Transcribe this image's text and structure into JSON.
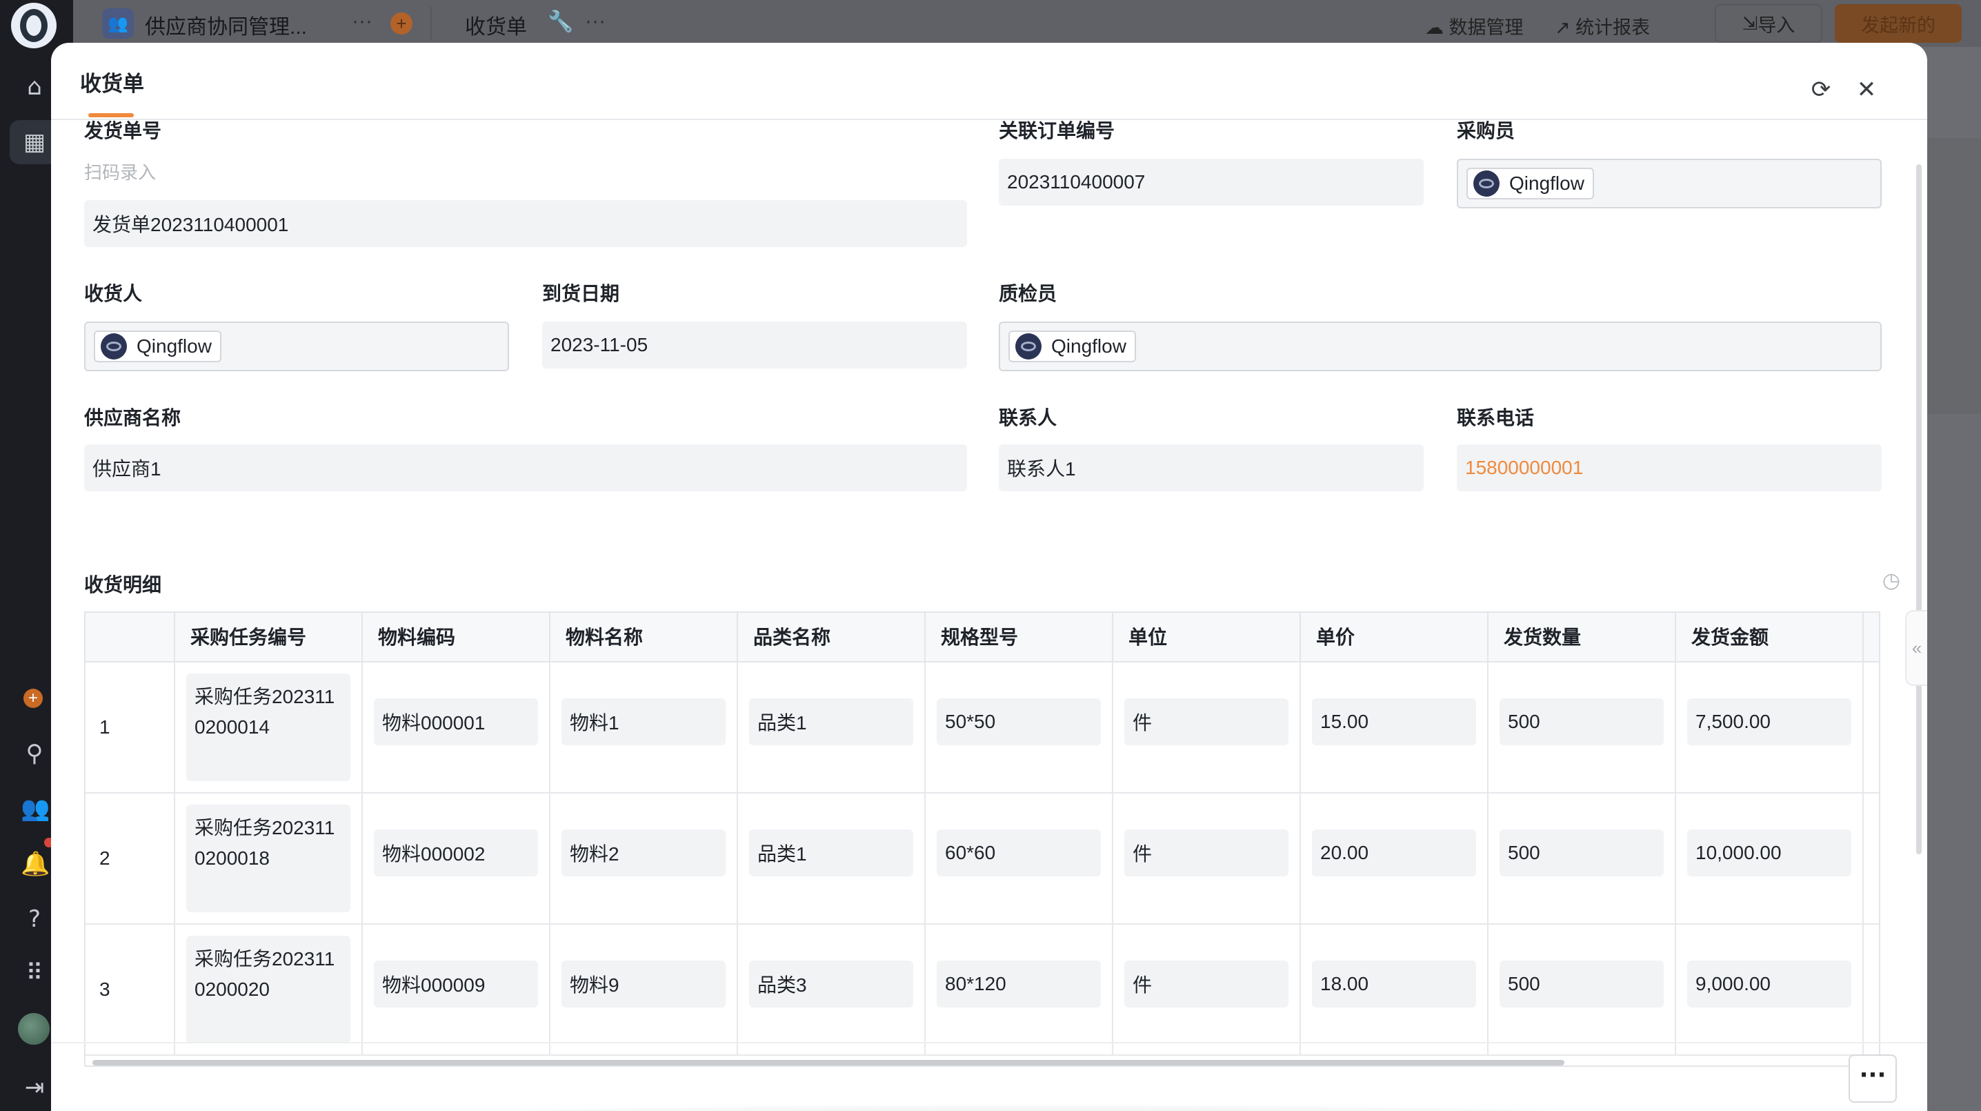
{
  "topbar": {
    "app_name": "供应商协同管理...",
    "more_dots": "···",
    "form_name": "收货单",
    "data_manage": "数据管理",
    "stats_report": "统计报表",
    "import": "导入",
    "new": "发起新的"
  },
  "modal": {
    "title": "收货单",
    "fields": {
      "shipment_no": {
        "label": "发货单号",
        "hint": "扫码录入",
        "value": "发货单2023110400001"
      },
      "order_no": {
        "label": "关联订单编号",
        "value": "2023110400007"
      },
      "purchaser": {
        "label": "采购员",
        "value": "Qingflow"
      },
      "receiver": {
        "label": "收货人",
        "value": "Qingflow"
      },
      "arrival_date": {
        "label": "到货日期",
        "value": "2023-11-05"
      },
      "inspector": {
        "label": "质检员",
        "value": "Qingflow"
      },
      "supplier": {
        "label": "供应商名称",
        "value": "供应商1"
      },
      "contact": {
        "label": "联系人",
        "value": "联系人1"
      },
      "phone": {
        "label": "联系电话",
        "value": "15800000001"
      }
    },
    "details": {
      "title": "收货明细",
      "columns": [
        "采购任务编号",
        "物料编码",
        "物料名称",
        "品类名称",
        "规格型号",
        "单位",
        "单价",
        "发货数量",
        "发货金额"
      ],
      "rows": [
        {
          "idx": "1",
          "task": "采购任务2023110200014",
          "code": "物料000001",
          "name": "物料1",
          "category": "品类1",
          "spec": "50*50",
          "unit": "件",
          "price": "15.00",
          "qty": "500",
          "amount": "7,500.00"
        },
        {
          "idx": "2",
          "task": "采购任务2023110200018",
          "code": "物料000002",
          "name": "物料2",
          "category": "品类1",
          "spec": "60*60",
          "unit": "件",
          "price": "20.00",
          "qty": "500",
          "amount": "10,000.00"
        },
        {
          "idx": "3",
          "task": "采购任务2023110200020",
          "code": "物料000009",
          "name": "物料9",
          "category": "品类3",
          "spec": "80*120",
          "unit": "件",
          "price": "18.00",
          "qty": "500",
          "amount": "9,000.00"
        }
      ]
    }
  }
}
